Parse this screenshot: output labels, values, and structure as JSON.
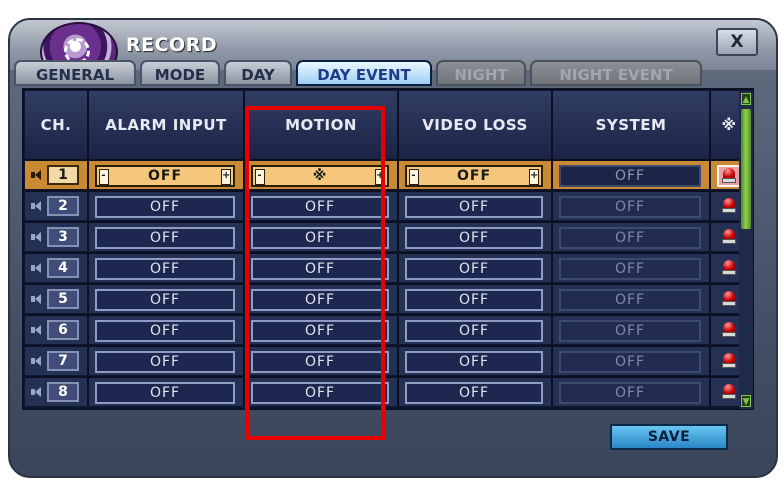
{
  "window": {
    "title": "RECORD",
    "close_label": "X"
  },
  "tabs": [
    {
      "label": "GENERAL",
      "state": "normal"
    },
    {
      "label": "MODE",
      "state": "normal"
    },
    {
      "label": "DAY",
      "state": "normal"
    },
    {
      "label": "DAY EVENT",
      "state": "active"
    },
    {
      "label": "NIGHT",
      "state": "disabled"
    },
    {
      "label": "NIGHT EVENT",
      "state": "disabled"
    }
  ],
  "table": {
    "headers": {
      "ch": "CH.",
      "alarm_input": "ALARM INPUT",
      "motion": "MOTION",
      "video_loss": "VIDEO LOSS",
      "system": "SYSTEM",
      "alarm_icon": "※"
    },
    "rows": [
      {
        "ch": "1",
        "alarm_input": "OFF",
        "motion": "※",
        "video_loss": "OFF",
        "system": "OFF",
        "selected": true
      },
      {
        "ch": "2",
        "alarm_input": "OFF",
        "motion": "OFF",
        "video_loss": "OFF",
        "system": "OFF",
        "selected": false
      },
      {
        "ch": "3",
        "alarm_input": "OFF",
        "motion": "OFF",
        "video_loss": "OFF",
        "system": "OFF",
        "selected": false
      },
      {
        "ch": "4",
        "alarm_input": "OFF",
        "motion": "OFF",
        "video_loss": "OFF",
        "system": "OFF",
        "selected": false
      },
      {
        "ch": "5",
        "alarm_input": "OFF",
        "motion": "OFF",
        "video_loss": "OFF",
        "system": "OFF",
        "selected": false
      },
      {
        "ch": "6",
        "alarm_input": "OFF",
        "motion": "OFF",
        "video_loss": "OFF",
        "system": "OFF",
        "selected": false
      },
      {
        "ch": "7",
        "alarm_input": "OFF",
        "motion": "OFF",
        "video_loss": "OFF",
        "system": "OFF",
        "selected": false
      },
      {
        "ch": "8",
        "alarm_input": "OFF",
        "motion": "OFF",
        "video_loss": "OFF",
        "system": "OFF",
        "selected": false
      }
    ],
    "spin_minus": "-",
    "spin_plus": "+"
  },
  "footer": {
    "save_label": "SAVE"
  },
  "colors": {
    "accent_active_tab": "#9fd0f3",
    "selected_row": "#c98a33",
    "highlight": "#e60000",
    "save_button": "#2a87c6"
  },
  "icons": {
    "logo": "disc-logo-icon",
    "speaker": "speaker-icon",
    "siren": "siren-icon",
    "close": "close-icon"
  }
}
